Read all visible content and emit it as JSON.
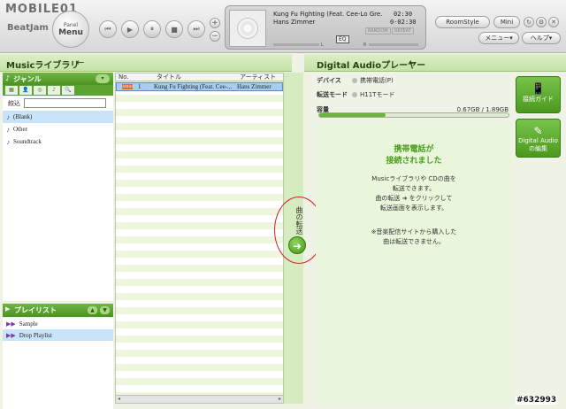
{
  "app": {
    "logo": "MOBILE01",
    "brand": "BeatJam"
  },
  "toolbar": {
    "panel_menu_small": "Panel",
    "panel_menu_big": "Menu",
    "prev": "⏮",
    "play": "▶",
    "pause": "⏸",
    "stop": "■",
    "next": "⏭",
    "vol_up": "+",
    "vol_down": "−",
    "room_style": "RoomStyle",
    "mini": "Mini",
    "menu": "メニュー▾",
    "help": "ヘルプ▾",
    "btn_a": "↻",
    "btn_b": "⚙",
    "btn_c": "✕"
  },
  "now_playing": {
    "title": "Kung Fu Fighting (Feat. Cee-Lo Gre...",
    "artist": "Hans Zimmer",
    "time_elapsed": "02:30",
    "time_remaining": "0-02:30",
    "eq": "EQ",
    "random": "RANDOM",
    "repeat": "REPEAT",
    "level_l": "L",
    "level_r": "R"
  },
  "library": {
    "title": "Musicライブラリ",
    "arrow": "←",
    "genre_header": "ジャンル",
    "genre_dropdown": "▾",
    "tools": [
      "▦",
      "👤",
      "◎",
      "♪",
      "🔍"
    ],
    "filter_label": "絞込",
    "filter_value": "",
    "genres": [
      {
        "label": "(Blank)",
        "selected": true
      },
      {
        "label": "Other",
        "selected": false
      },
      {
        "label": "Soundtrack",
        "selected": false
      }
    ],
    "playlist_header": "プレイリスト",
    "playlist_up": "▲",
    "playlist_down": "▼",
    "playlists": [
      {
        "label": "Sample",
        "selected": false
      },
      {
        "label": "Drop Playlist",
        "selected": true
      }
    ]
  },
  "tracks": {
    "columns": {
      "no": "No.",
      "title": "タイトル",
      "artist": "アーティスト"
    },
    "rows": [
      {
        "status": "ATRAC",
        "no": "1",
        "title": "Kung Fu Fighting (Feat. Cee-...",
        "artist": "Hans Zimmer"
      }
    ],
    "scroll_left": "◂",
    "scroll_right": "▸"
  },
  "transfer": {
    "label": "曲の転送",
    "button": "➜"
  },
  "device_panel": {
    "title": "Digital Audioプレーヤー",
    "arrow": "←",
    "device_label": "デバイス",
    "device_value": "携帯電話(P)",
    "mode_label": "転送モード",
    "mode_value": "H11Tモード",
    "capacity_label": "容量",
    "capacity_value": "0.67GB / 1.89GB",
    "capacity_fraction": 0.35,
    "heading_line1": "携帯電話が",
    "heading_line2": "接続されました",
    "body_line1": "Musicライブラリや CDの曲を",
    "body_line2": "転送できます。",
    "body_line3": "曲の転送 ➜ をクリックして",
    "body_line4": "転送画面を表示します。",
    "note_line1": "※音楽配信サイトから購入した",
    "note_line2": "曲は転送できません。",
    "guide_button": "接続ガイド",
    "edit_button_line1": "Digital Audio",
    "edit_button_line2": "の編集"
  },
  "watermark": "#632993"
}
